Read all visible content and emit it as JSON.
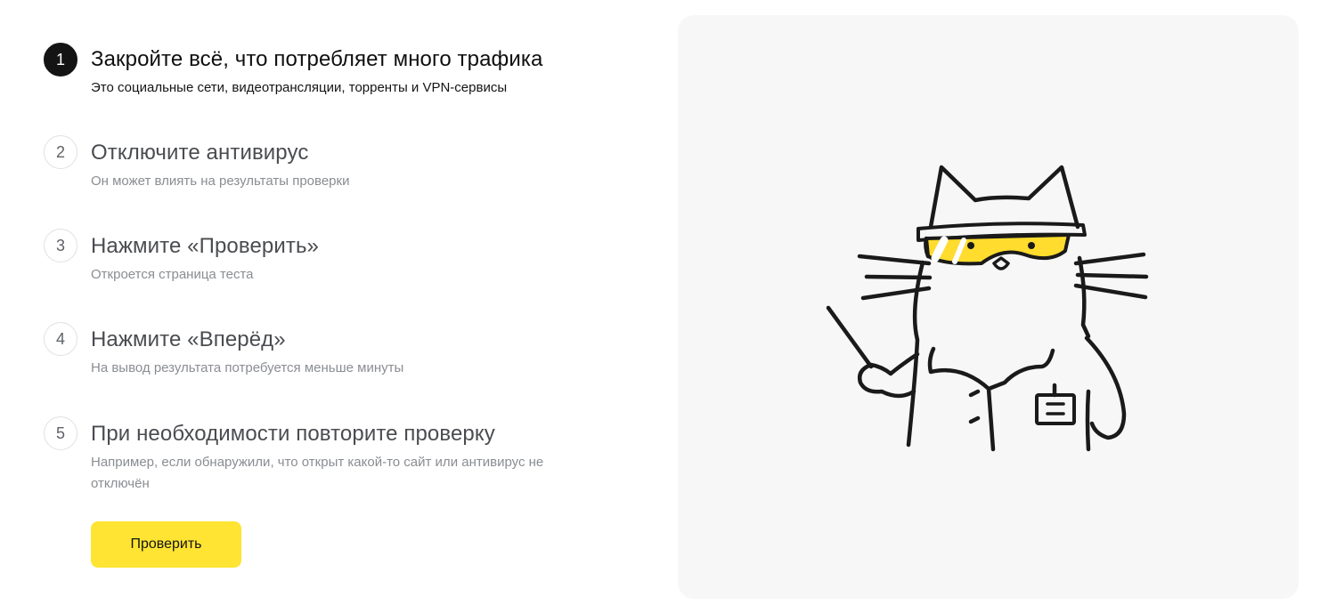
{
  "steps": [
    {
      "number": "1",
      "title": "Закройте всё, что потребляет много трафика",
      "description": "Это социальные сети, видеотрансляции, торренты и VPN-сервисы",
      "active": true
    },
    {
      "number": "2",
      "title": "Отключите антивирус",
      "description": "Он может влиять на результаты проверки",
      "active": false
    },
    {
      "number": "3",
      "title": "Нажмите «Проверить»",
      "description": "Откроется страница теста",
      "active": false
    },
    {
      "number": "4",
      "title": "Нажмите «Вперёд»",
      "description": "На вывод результата потребуется меньше минуты",
      "active": false
    },
    {
      "number": "5",
      "title": "При необходимости повторите проверку",
      "description": "Например, если обнаружили, что открыт какой-то сайт или антивирус не отключён",
      "active": false
    }
  ],
  "check_button": {
    "label": "Проверить"
  },
  "illustration": {
    "icon": "cat-scientist-illustration"
  },
  "colors": {
    "accent": "#FFE433",
    "active_step": "#141414",
    "panel_bg": "#F7F7F7"
  }
}
